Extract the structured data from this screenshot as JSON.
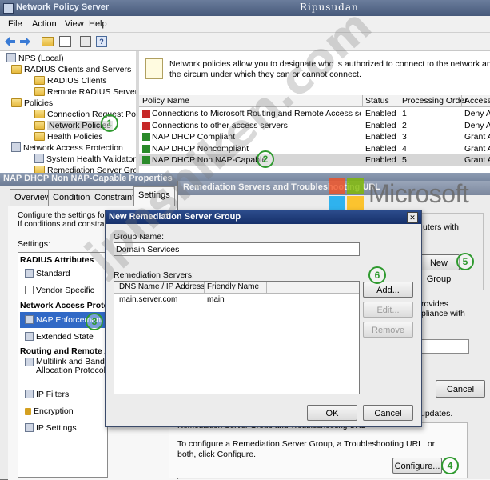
{
  "watermark_top": "Ripusudan",
  "watermark_diag": "jpnshiken.com",
  "mmc": {
    "title": "Network Policy Server",
    "menu": [
      "File",
      "Action",
      "View",
      "Help"
    ],
    "tree": [
      {
        "label": "NPS (Local)"
      },
      {
        "label": "RADIUS Clients and Servers"
      },
      {
        "label": "RADIUS Clients"
      },
      {
        "label": "Remote RADIUS Server G"
      },
      {
        "label": "Policies"
      },
      {
        "label": "Connection Request Polici"
      },
      {
        "label": "Network Policies"
      },
      {
        "label": "Health Policies"
      },
      {
        "label": "Network Access Protection"
      },
      {
        "label": "System Health Validators"
      },
      {
        "label": "Remediation Server Grou"
      }
    ],
    "info_text": "Network policies allow you to designate who is authorized to connect to the network and the circum under which they can or cannot connect.",
    "columns": [
      "Policy Name",
      "Status",
      "Processing Order",
      "Access"
    ],
    "rows": [
      {
        "name": "Connections to Microsoft Routing and Remote Access server",
        "status": "Enabled",
        "order": "1",
        "access": "Deny A",
        "icon": "deny"
      },
      {
        "name": "Connections to other access servers",
        "status": "Enabled",
        "order": "2",
        "access": "Deny A",
        "icon": "deny"
      },
      {
        "name": "NAP DHCP Compliant",
        "status": "Enabled",
        "order": "3",
        "access": "Grant A",
        "icon": "grant"
      },
      {
        "name": "NAP DHCP Noncompliant",
        "status": "Enabled",
        "order": "4",
        "access": "Grant A",
        "icon": "grant"
      },
      {
        "name": "NAP DHCP Non NAP-Capable",
        "status": "Enabled",
        "order": "5",
        "access": "Grant A",
        "icon": "grant"
      }
    ]
  },
  "props": {
    "title": "NAP DHCP Non NAP-Capable Properties",
    "tabs": [
      "Overview",
      "Conditions",
      "Constraints",
      "Settings"
    ],
    "desc": "Configure the settings for th\nIf conditions and constraint",
    "settings_label": "Settings:",
    "groups": {
      "radius": "RADIUS Attributes",
      "nap": "Network Access Prote",
      "rras": "Routing and Remote A"
    },
    "items": {
      "standard": "Standard",
      "vendor": "Vendor Specific",
      "nap_enf": "NAP Enforcement",
      "ext_state": "Extended State",
      "multilink": "Multilink and Bandv\nAllocation Protocol",
      "ip_filters": "IP Filters",
      "encryption": "Encryption",
      "ip_settings": "IP Settings"
    },
    "cancel": "Cancel",
    "bottom_updates": "updates."
  },
  "remed": {
    "title": "Remediation Servers and Troubleshooting URL",
    "frag_with": "uters with",
    "new_group": "New Group",
    "frag_provides": "rovides\npliance with",
    "group_label": "Remediation Server Group and Troubleshooting URL",
    "group_text": "To configure a Remediation Server Group, a Troubleshooting URL, or both, click Configure.",
    "configure": "Configure..."
  },
  "dialog": {
    "title": "New Remediation Server Group",
    "close": "✕",
    "group_name_label": "Group Name:",
    "group_name_value": "Domain Services",
    "servers_label": "Remediation Servers:",
    "columns": [
      "DNS Name / IP Address",
      "Friendly Name"
    ],
    "servers": [
      {
        "address": "main.server.com",
        "friendly": "main"
      }
    ],
    "add": "Add...",
    "edit": "Edit...",
    "remove": "Remove",
    "ok": "OK",
    "cancel": "Cancel"
  },
  "brand": {
    "name": "Microsoft"
  },
  "markers": [
    "1",
    "2",
    "3",
    "4",
    "5",
    "6"
  ],
  "colors": {
    "titlebar_active": "#0a246a",
    "selection": "#3169c6",
    "marker": "#2f9a2f",
    "grant": "#2a8a2a",
    "deny": "#c62828"
  }
}
